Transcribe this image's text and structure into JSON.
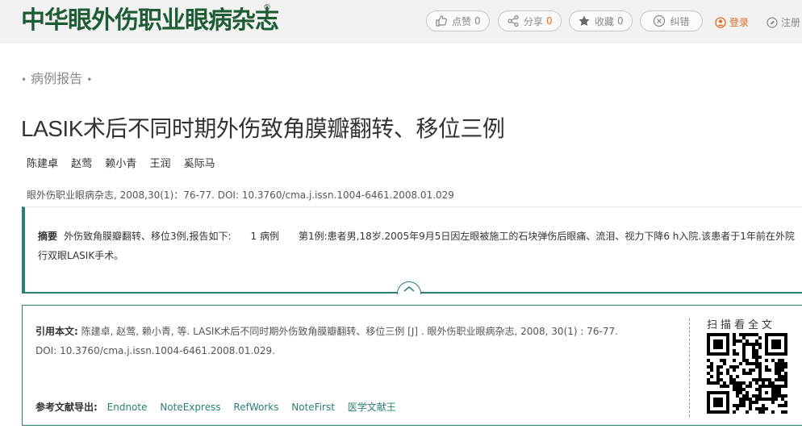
{
  "header": {
    "logo": "中华眼外伤职业眼病杂志",
    "logo_reg": "®",
    "actions": [
      {
        "label": "点赞",
        "count": "0",
        "icon": "thumbs-up-icon"
      },
      {
        "label": "分享",
        "count": "0",
        "icon": "share-icon"
      },
      {
        "label": "收藏",
        "count": "0",
        "icon": "star-icon"
      },
      {
        "label": "纠错",
        "count": "",
        "icon": "close-circle-icon"
      }
    ],
    "login": "登录",
    "register": "注册",
    "accent": "#e06a1f"
  },
  "article": {
    "section": "病例报告",
    "title": "LASIK术后不同时期外伤致角膜瓣翻转、移位三例",
    "authors": [
      "陈建卓",
      "赵莺",
      "赖小青",
      "王润",
      "奚际马"
    ],
    "citation_line": "眼外伤职业眼病杂志, 2008,30(1)：76-77. DOI: 10.3760/cma.j.issn.1004-6461.2008.01.029",
    "abstract_label": "摘要",
    "abstract_text": "外伤致角膜瓣翻转、移位3例,报告如下:　　1 病例　　第1例:患者男,18岁.2005年9月5日因左眼被施工的石块弹伤后眼痛、流泪、视力下降6 h入院.该患者于1年前在外院行双眼LASIK手术。"
  },
  "cite": {
    "label": "引用本文:",
    "text": " 陈建卓, 赵莺, 赖小青, 等.  LASIK术后不同时期外伤致角膜瓣翻转、移位三例 [J] . 眼外伤职业眼病杂志, 2008, 30(1) : 76-77. DOI: 10.3760/cma.j.issn.1004-6461.2008.01.029.",
    "export_label": "参考文献导出:",
    "export_links": [
      "Endnote",
      "NoteExpress",
      "RefWorks",
      "NoteFirst",
      "医学文献王"
    ],
    "scan_label": "扫描看全文"
  },
  "colors": {
    "brand": "#1d5c34",
    "teal": "#2a7f73"
  }
}
